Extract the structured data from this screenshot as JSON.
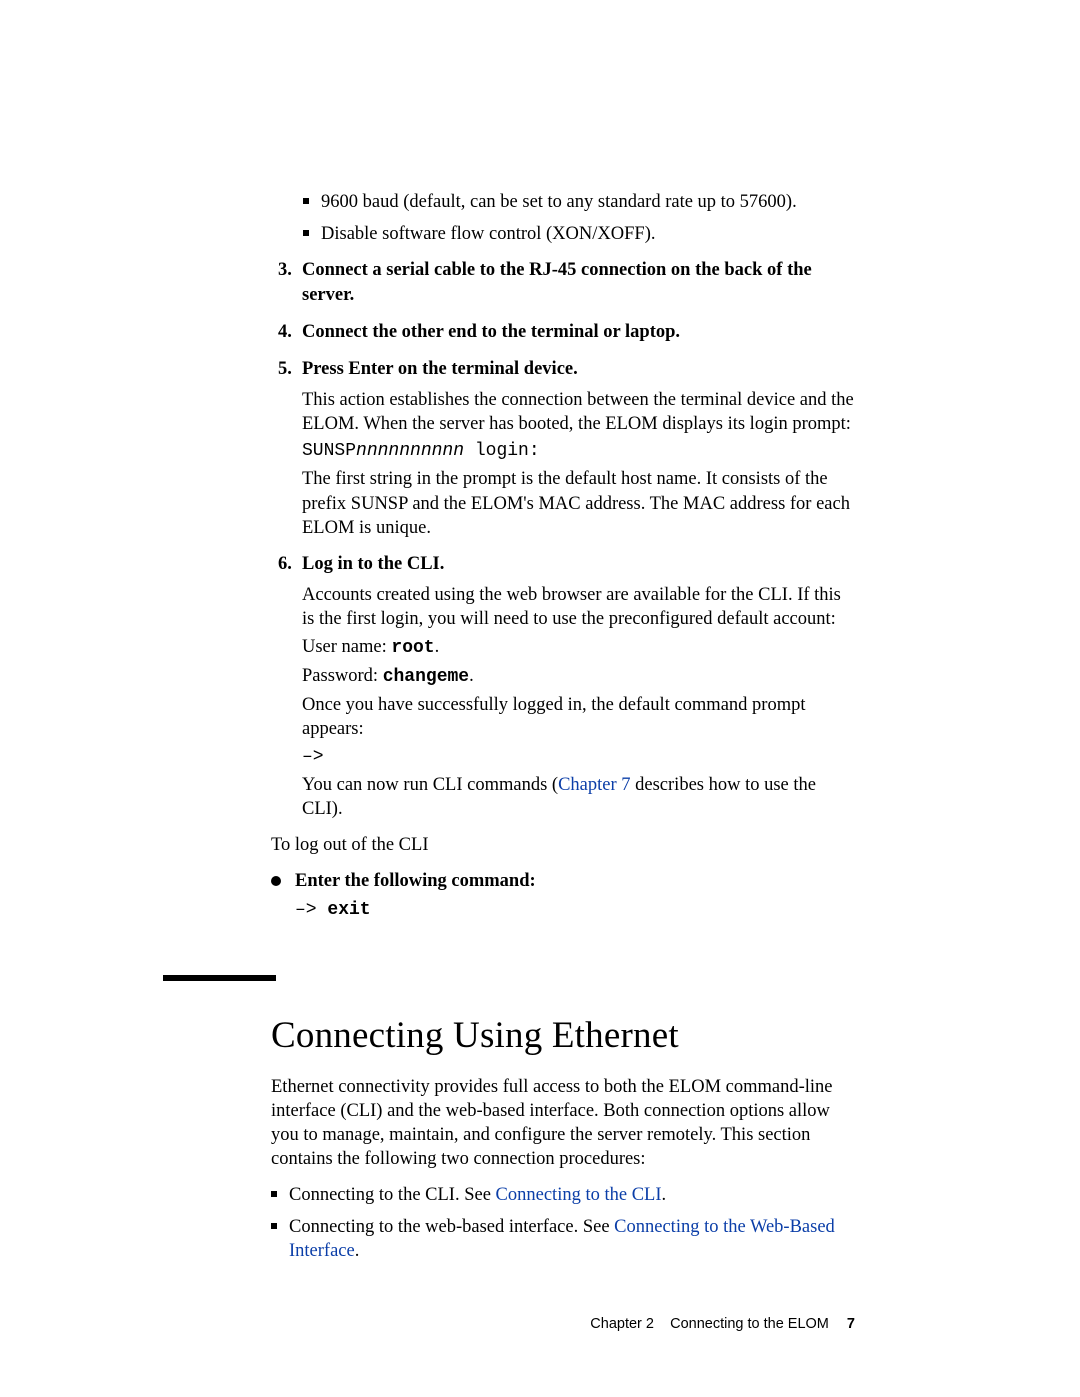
{
  "settings_bullets": [
    "9600 baud (default, can be set to any standard rate up to 57600).",
    "Disable software flow control (XON/XOFF)."
  ],
  "steps": {
    "s3": {
      "num": "3.",
      "text": "Connect a serial cable to the RJ-45 connection on the back of the server."
    },
    "s4": {
      "num": "4.",
      "text": "Connect the other end to the terminal or laptop."
    },
    "s5": {
      "num": "5.",
      "text": "Press Enter on the terminal device.",
      "para1": "This action establishes the connection between the terminal device and the ELOM. When the server has booted, the ELOM displays its login prompt:",
      "code_prefix": "SUNSP",
      "code_mid": "nnnnnnnnnn",
      "code_suffix": " login:",
      "para2": "The first string in the prompt is the default host name. It consists of the prefix SUNSP and the ELOM's MAC address. The MAC address for each ELOM is unique."
    },
    "s6": {
      "num": "6.",
      "text": "Log in to the CLI.",
      "para1": "Accounts created using the web browser are available for the CLI. If this is the first login, you will need to use the preconfigured default account:",
      "user_label": "User name: ",
      "user_value": "root",
      "pass_label": "Password: ",
      "pass_value": "changeme",
      "para2": "Once you have successfully logged in, the default command prompt appears:",
      "prompt": "–>",
      "para3a": "You can now run CLI commands (",
      "para3_link": "Chapter 7",
      "para3b": " describes how to use the CLI)."
    }
  },
  "logout_line": "To log out of the CLI",
  "enter_cmd_label": "Enter the following command:",
  "exit_prompt": "–> ",
  "exit_cmd": "exit",
  "heading": "Connecting Using Ethernet",
  "intro": "Ethernet connectivity provides full access to both the ELOM command-line interface (CLI) and the web-based interface. Both connection options allow you to manage, maintain, and configure the server remotely. This section contains the following two connection procedures:",
  "conn_bullets": {
    "b1a": "Connecting to the CLI. See ",
    "b1_link": "Connecting to the CLI",
    "b1b": ".",
    "b2a": "Connecting to the web-based interface. See ",
    "b2_link": "Connecting to the Web-Based Interface",
    "b2b": "."
  },
  "footer": {
    "chapter": "Chapter 2",
    "title": "Connecting to the ELOM",
    "page": "7"
  }
}
